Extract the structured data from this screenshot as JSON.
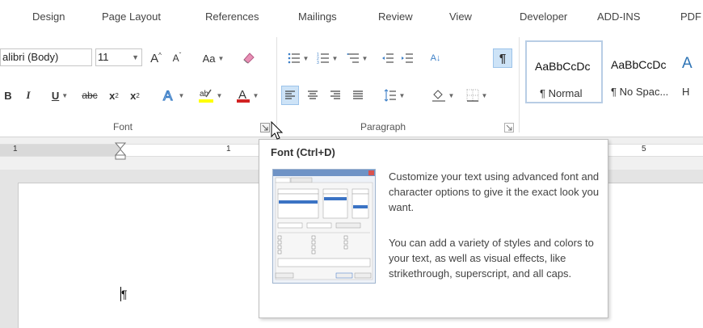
{
  "tabs": [
    "Design",
    "Page Layout",
    "References",
    "Mailings",
    "Review",
    "View",
    "Developer",
    "ADD-INS",
    "PDF"
  ],
  "font_group": {
    "font_name": "alibri (Body)",
    "font_size": "11",
    "grow_label": "A",
    "shrink_label": "A",
    "case_label": "Aa",
    "strike_label": "abc",
    "sub_label": "x",
    "sub_mark": "2",
    "sup_label": "x",
    "sup_mark": "2",
    "label": "Font"
  },
  "paragraph_group": {
    "sort_label": "A↓",
    "pilcrow_label": "¶",
    "label": "Paragraph"
  },
  "styles": [
    {
      "sample": "AaBbCcDc",
      "name": "¶ Normal",
      "selected": true
    },
    {
      "sample": "AaBbCcDc",
      "name": "¶ No Spac...",
      "selected": false
    },
    {
      "sample": "A",
      "name": "H",
      "selected": false
    }
  ],
  "ruler": {
    "numbers": [
      "1",
      "1",
      "5"
    ]
  },
  "document": {
    "pilcrow": "¶"
  },
  "tooltip": {
    "title": "Font (Ctrl+D)",
    "para1": "Customize your text using advanced font and character options to give it the exact look you want.",
    "para2": "You can add a variety of styles and colors to your text, as well as visual effects, like strikethrough, superscript, and all caps."
  },
  "colors": {
    "highlight": "#ffff00",
    "font_color": "#d22222",
    "text_effect": "#3c7fc7",
    "selected_border": "#b8cde5",
    "active_button": "#cde3f7"
  }
}
